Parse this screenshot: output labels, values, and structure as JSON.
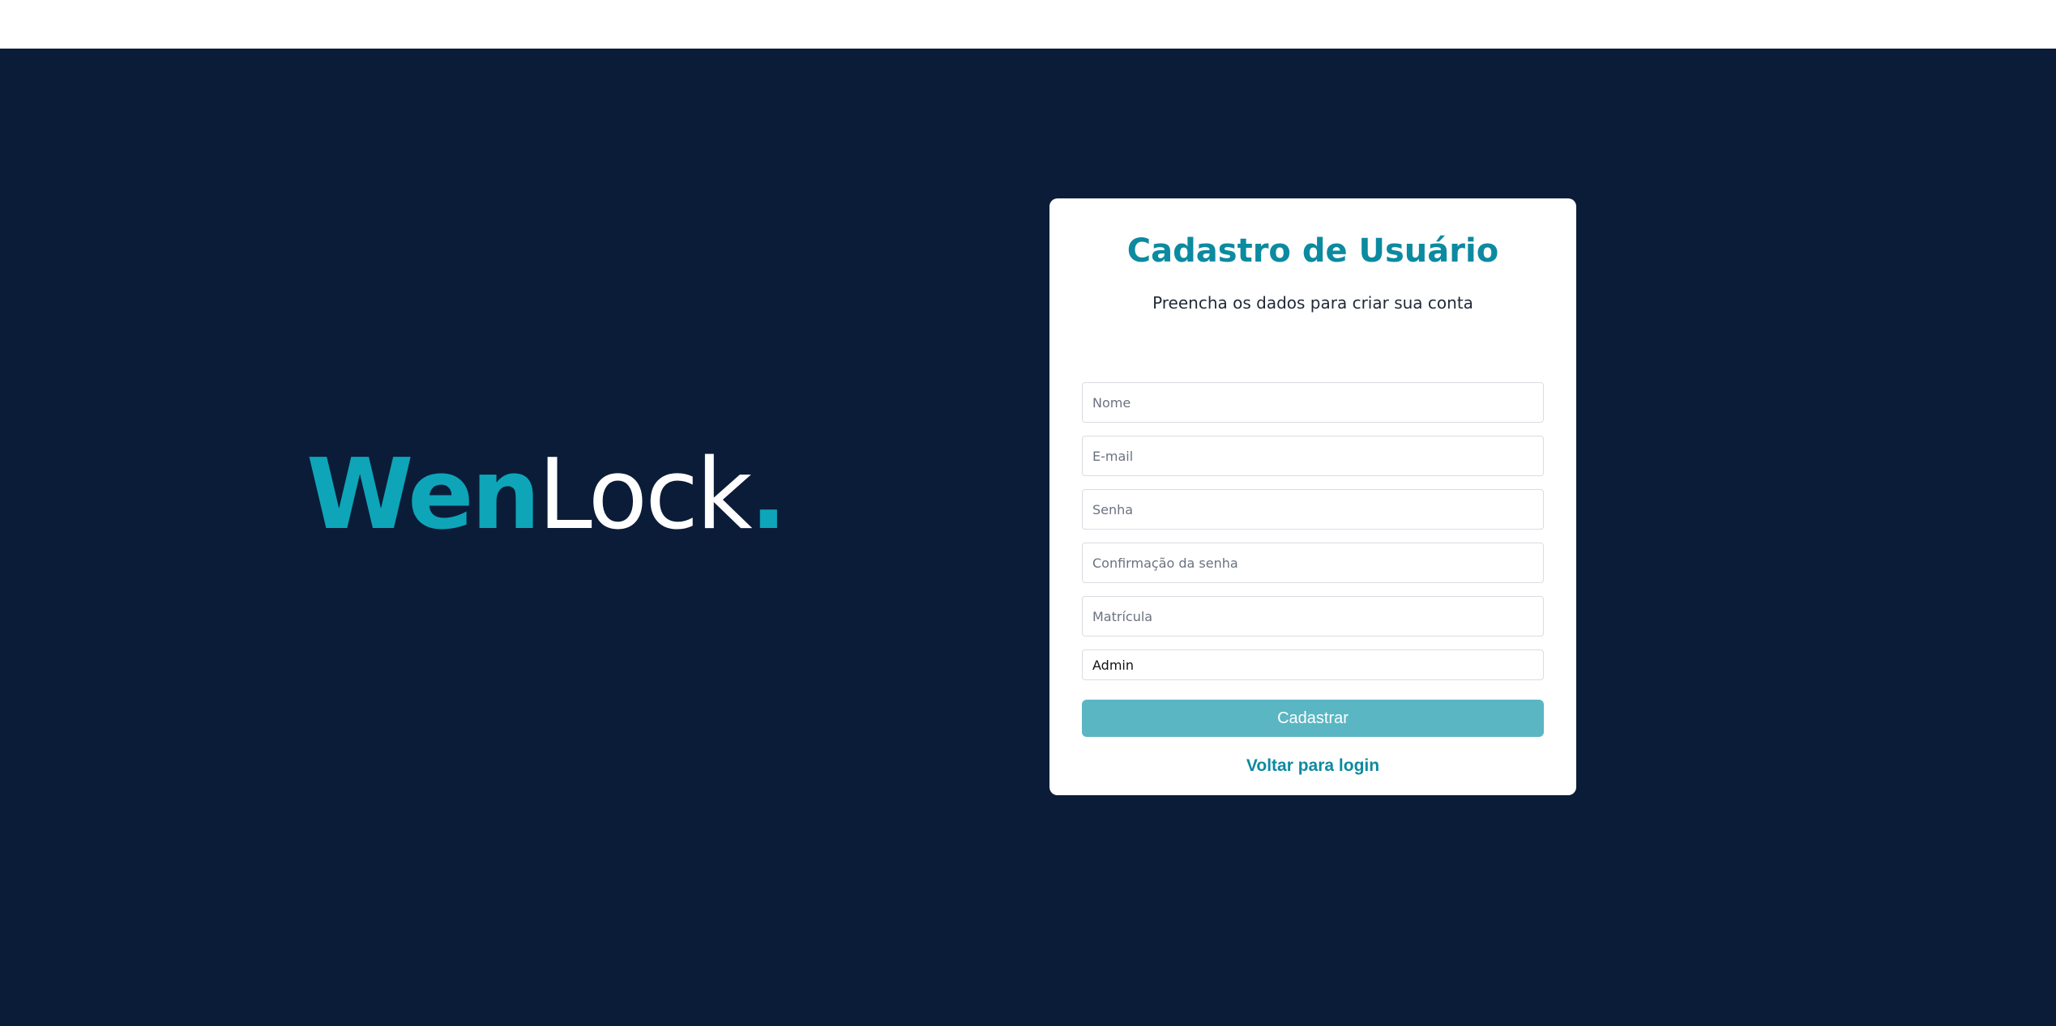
{
  "brand": {
    "part1": "Wen",
    "part2": "Lock",
    "dot": "."
  },
  "form": {
    "title": "Cadastro de Usuário",
    "subtitle": "Preencha os dados para criar sua conta",
    "fields": {
      "name_placeholder": "Nome",
      "email_placeholder": "E-mail",
      "password_placeholder": "Senha",
      "password_confirm_placeholder": "Confirmação da senha",
      "registration_placeholder": "Matrícula"
    },
    "role_selected": "Admin",
    "submit_label": "Cadastrar",
    "back_link_label": "Voltar para login"
  },
  "colors": {
    "background": "#0b1c38",
    "accent": "#0ea5b9",
    "title": "#0c8aa0",
    "button": "#5ab6c3"
  }
}
